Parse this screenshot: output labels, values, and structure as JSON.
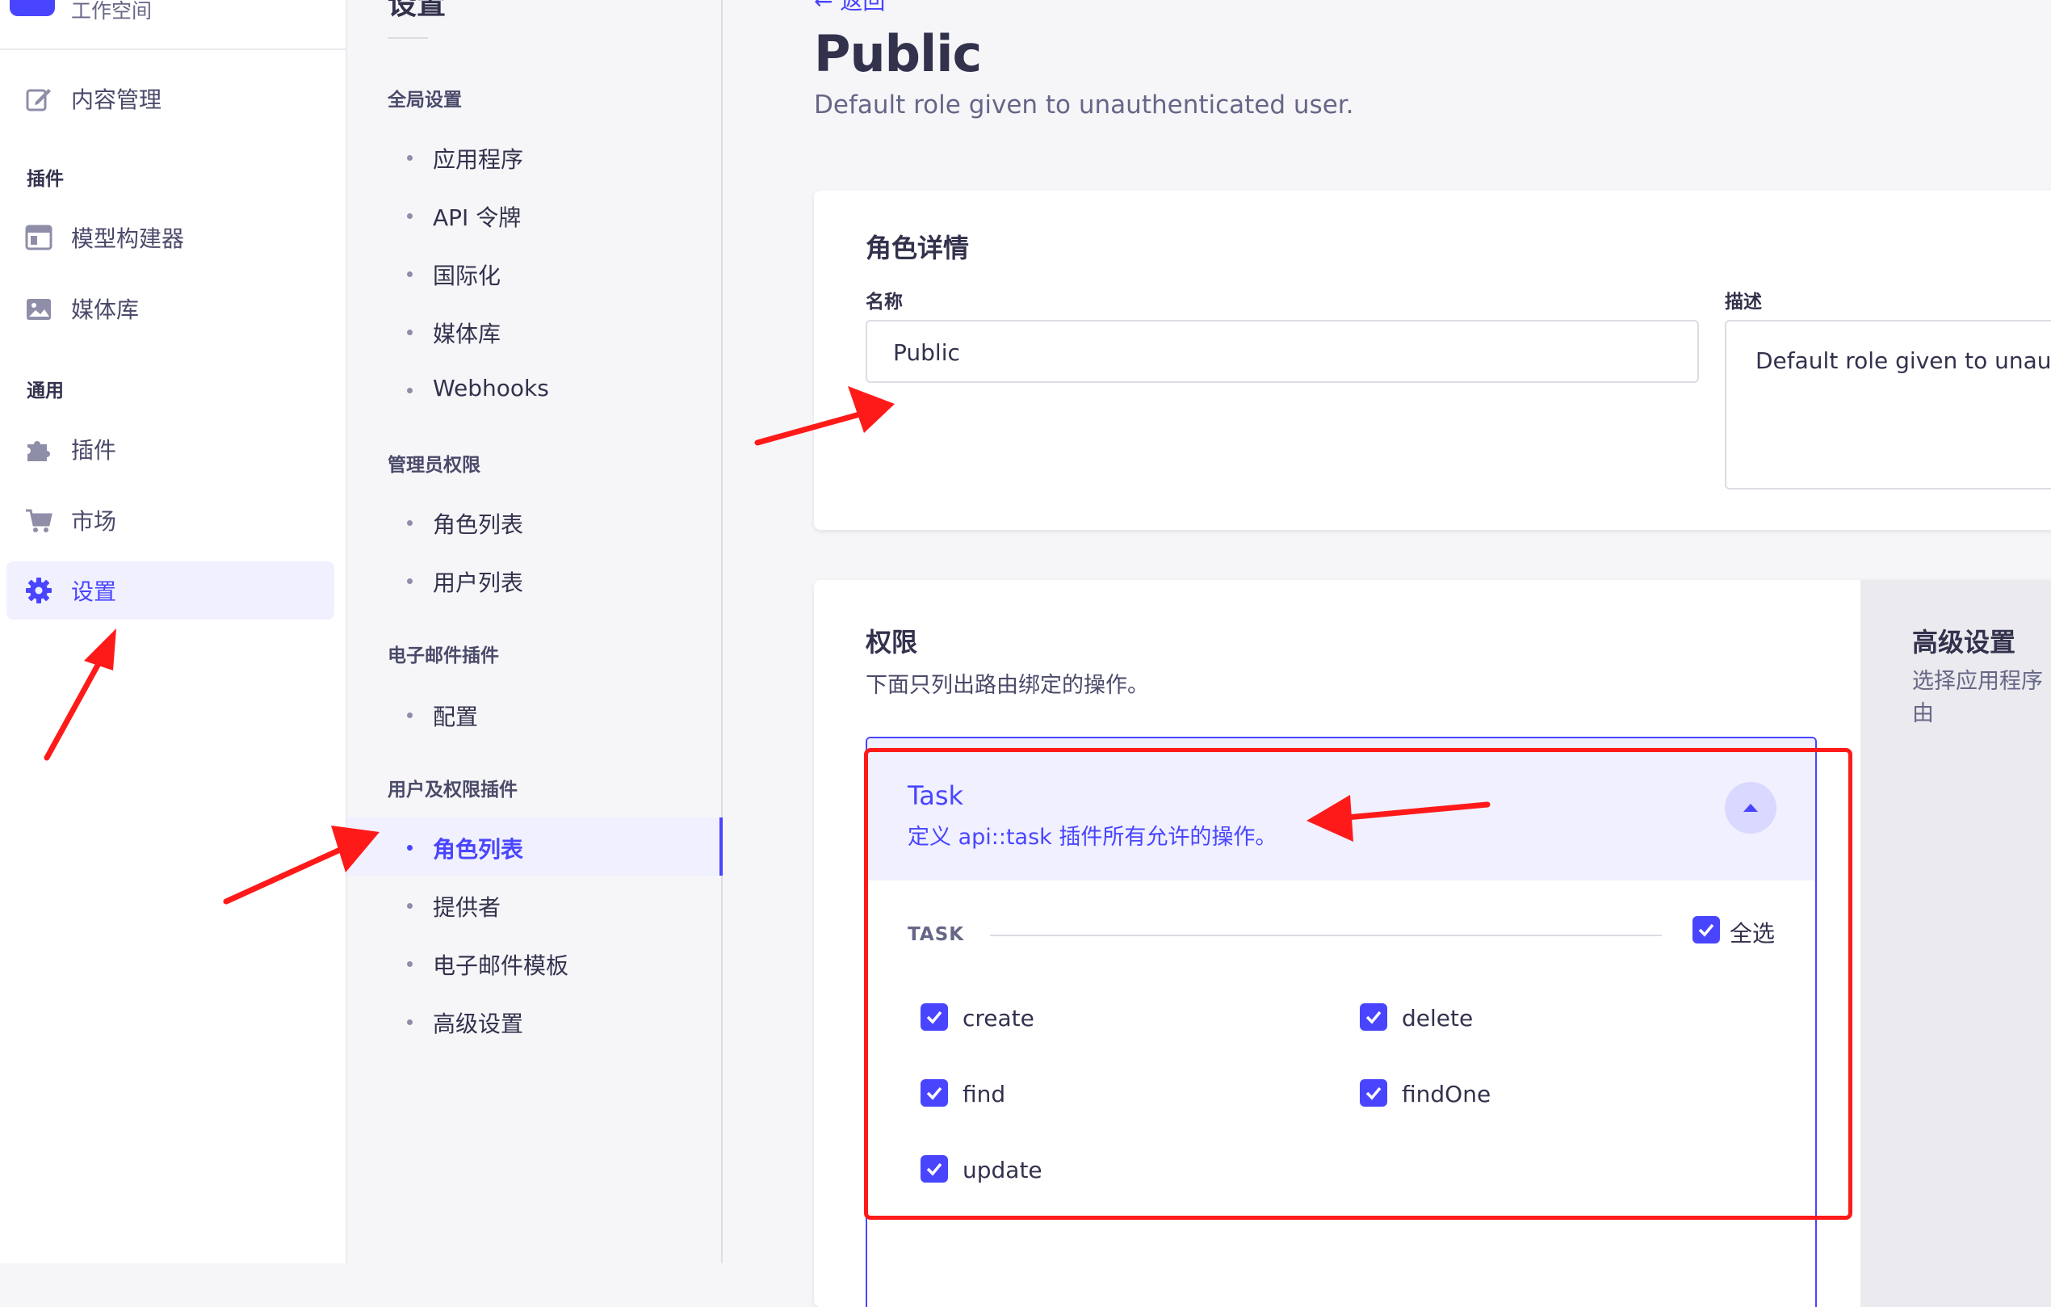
{
  "mainnav": {
    "workspace_label": "工作空间",
    "items": {
      "content": "内容管理",
      "plugins_section": "插件",
      "model_builder": "模型构建器",
      "media_library": "媒体库",
      "general_section": "通用",
      "plugins": "插件",
      "marketplace": "市场",
      "settings": "设置"
    }
  },
  "subnav": {
    "title": "设置",
    "global_section": "全局设置",
    "global_items": [
      "应用程序",
      "API 令牌",
      "国际化",
      "媒体库",
      "Webhooks"
    ],
    "admin_section": "管理员权限",
    "admin_items": [
      "角色列表",
      "用户列表"
    ],
    "email_section": "电子邮件插件",
    "email_items": [
      "配置"
    ],
    "up_section": "用户及权限插件",
    "up_items": [
      "角色列表",
      "提供者",
      "电子邮件模板",
      "高级设置"
    ],
    "active_item": "角色列表"
  },
  "header": {
    "back_label": "← 返回",
    "title": "Public",
    "subtitle": "Default role given to unauthenticated user."
  },
  "details": {
    "heading": "角色详情",
    "name_label": "名称",
    "name_value": "Public",
    "description_label": "描述",
    "description_value": "Default role given to unauthenticated user."
  },
  "permissions": {
    "heading": "权限",
    "description": "下面只列出路由绑定的操作。",
    "accordion": {
      "title": "Task",
      "description": "定义 api::task 插件所有允许的操作。",
      "expanded": true,
      "group_label": "TASK",
      "select_all_label": "全选",
      "select_all_checked": true,
      "actions": [
        {
          "label": "create",
          "checked": true
        },
        {
          "label": "delete",
          "checked": true
        },
        {
          "label": "find",
          "checked": true
        },
        {
          "label": "findOne",
          "checked": true
        },
        {
          "label": "update",
          "checked": true
        }
      ]
    }
  },
  "advanced": {
    "heading": "高级设置",
    "description_line1": "选择应用程序",
    "description_line2": "由"
  },
  "colors": {
    "accent": "#4945ff",
    "active_bg": "#f0f0ff",
    "annotation": "#ff1a1a"
  },
  "icons": [
    "content-manager-icon",
    "layout-icon",
    "media-icon",
    "puzzle-icon",
    "cart-icon",
    "gear-icon",
    "chevron-up-icon",
    "check-icon",
    "arrow-left-icon"
  ]
}
